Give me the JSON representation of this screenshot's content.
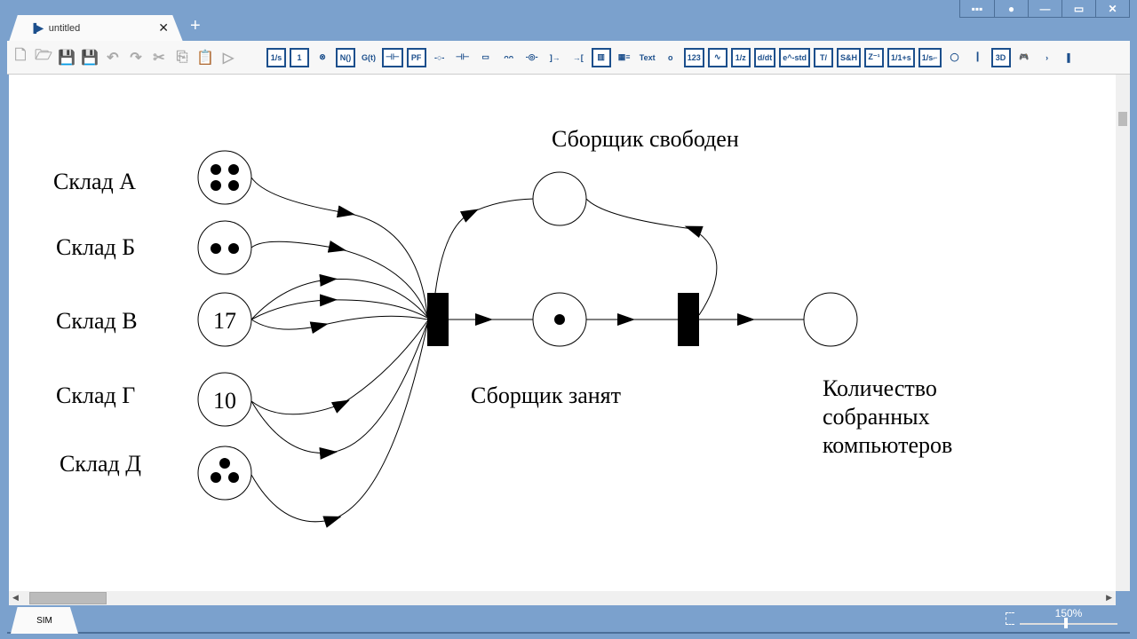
{
  "window": {
    "tab_title": "untitled",
    "new_tab": "+",
    "tab_close": "✕",
    "buttons": [
      "▪▪▪",
      "●",
      "—",
      "▭",
      "✕"
    ]
  },
  "toolbar": {
    "file_tools": [
      "new-file",
      "open-folder",
      "save",
      "save-as",
      "undo",
      "redo",
      "cut",
      "copy",
      "paste",
      "run"
    ],
    "blocks": [
      {
        "icon": "integrator",
        "label": "1/s"
      },
      {
        "icon": "constant",
        "label": "1"
      },
      {
        "icon": "product",
        "label": "⊗"
      },
      {
        "icon": "function",
        "label": "N()"
      },
      {
        "icon": "signal",
        "label": "G(t)"
      },
      {
        "icon": "mux",
        "label": "⊣⊢"
      },
      {
        "icon": "pf",
        "label": "PF"
      },
      {
        "icon": "node",
        "label": "-○-"
      },
      {
        "icon": "capacitor",
        "label": "⊣⊢"
      },
      {
        "icon": "resistor",
        "label": "▭"
      },
      {
        "icon": "inductor",
        "label": "ᴖᴖ"
      },
      {
        "icon": "source",
        "label": "-◎-"
      },
      {
        "icon": "out-port",
        "label": "]→"
      },
      {
        "icon": "in-port",
        "label": "→["
      },
      {
        "icon": "table",
        "label": "▥"
      },
      {
        "icon": "display",
        "label": "▦≡"
      },
      {
        "icon": "text",
        "label": "Text"
      },
      {
        "icon": "point",
        "label": "o"
      },
      {
        "icon": "numeric-display",
        "label": "123"
      },
      {
        "icon": "scope",
        "label": "∿"
      },
      {
        "icon": "discrete-integrator",
        "label": "1/z"
      },
      {
        "icon": "derivative",
        "label": "d/dt"
      },
      {
        "icon": "delay",
        "label": "e^-std"
      },
      {
        "icon": "zero-order",
        "label": "T/"
      },
      {
        "icon": "sample-hold",
        "label": "S&H"
      },
      {
        "icon": "unit-delay",
        "label": "Z⁻¹"
      },
      {
        "icon": "transfer",
        "label": "1/1+s"
      },
      {
        "icon": "limited-integrator",
        "label": "1/s⌐"
      },
      {
        "icon": "circle",
        "label": "◯"
      },
      {
        "icon": "bus",
        "label": "┃"
      },
      {
        "icon": "3d",
        "label": "3D"
      },
      {
        "icon": "gamepad",
        "label": "🎮"
      },
      {
        "icon": "chevron-right",
        "label": "›"
      },
      {
        "icon": "panel-toggle",
        "label": "▌"
      }
    ]
  },
  "net": {
    "places": [
      {
        "name": "Склад А",
        "tokens": 4
      },
      {
        "name": "Склад Б",
        "tokens": 2
      },
      {
        "name": "Склад В",
        "tokens": 17
      },
      {
        "name": "Склад Г",
        "tokens": 10
      },
      {
        "name": "Склад Д",
        "tokens": 3
      },
      {
        "name": "Сборщик свободен",
        "tokens": 0
      },
      {
        "name": "Сборщик занят",
        "tokens": 1
      },
      {
        "name": "Количество собранных компьютеров",
        "tokens": 0
      }
    ],
    "labels": {
      "a": "Склад А",
      "b": "Склад Б",
      "v": "Склад В",
      "g": "Склад Г",
      "d": "Склад Д",
      "free": "Сборщик свободен",
      "busy": "Сборщик занят",
      "count1": "Количество",
      "count2": "собранных",
      "count3": "компьютеров"
    },
    "token_counts": {
      "v": "17",
      "g": "10"
    }
  },
  "bottom": {
    "tab": "SIM",
    "zoom": "150%",
    "zoom_fraction": 0.45
  }
}
